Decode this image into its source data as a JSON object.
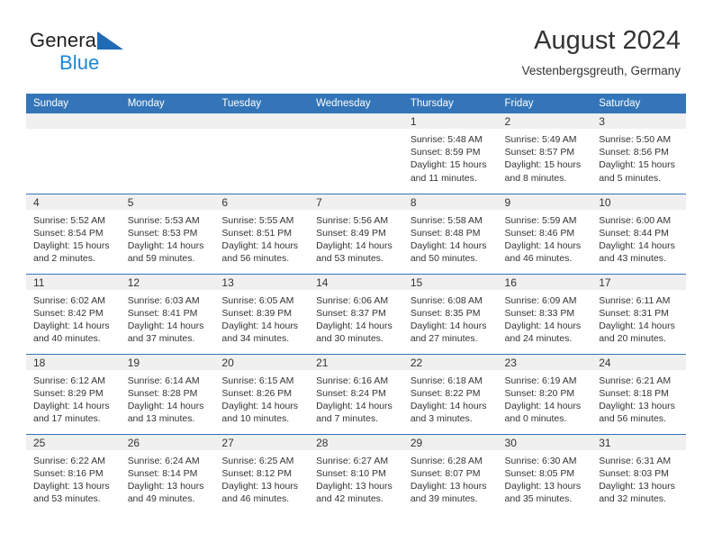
{
  "brand": {
    "name_part1": "General",
    "name_part2": "Blue",
    "triangle_color": "#1f6cb5",
    "blue_color": "#1b87d6"
  },
  "header": {
    "title": "August 2024",
    "subtitle": "Vestenbergsgreuth, Germany"
  },
  "theme": {
    "header_blue": "#3375b8",
    "daynum_gray": "#f0f0f0",
    "text": "#333333"
  },
  "calendar": {
    "weekday_headers": [
      "Sunday",
      "Monday",
      "Tuesday",
      "Wednesday",
      "Thursday",
      "Friday",
      "Saturday"
    ],
    "weeks": [
      [
        {
          "day": "",
          "empty": true
        },
        {
          "day": "",
          "empty": true
        },
        {
          "day": "",
          "empty": true
        },
        {
          "day": "",
          "empty": true
        },
        {
          "day": "1",
          "sunrise": "Sunrise: 5:48 AM",
          "sunset": "Sunset: 8:59 PM",
          "daylight1": "Daylight: 15 hours",
          "daylight2": "and 11 minutes."
        },
        {
          "day": "2",
          "sunrise": "Sunrise: 5:49 AM",
          "sunset": "Sunset: 8:57 PM",
          "daylight1": "Daylight: 15 hours",
          "daylight2": "and 8 minutes."
        },
        {
          "day": "3",
          "sunrise": "Sunrise: 5:50 AM",
          "sunset": "Sunset: 8:56 PM",
          "daylight1": "Daylight: 15 hours",
          "daylight2": "and 5 minutes."
        }
      ],
      [
        {
          "day": "4",
          "sunrise": "Sunrise: 5:52 AM",
          "sunset": "Sunset: 8:54 PM",
          "daylight1": "Daylight: 15 hours",
          "daylight2": "and 2 minutes."
        },
        {
          "day": "5",
          "sunrise": "Sunrise: 5:53 AM",
          "sunset": "Sunset: 8:53 PM",
          "daylight1": "Daylight: 14 hours",
          "daylight2": "and 59 minutes."
        },
        {
          "day": "6",
          "sunrise": "Sunrise: 5:55 AM",
          "sunset": "Sunset: 8:51 PM",
          "daylight1": "Daylight: 14 hours",
          "daylight2": "and 56 minutes."
        },
        {
          "day": "7",
          "sunrise": "Sunrise: 5:56 AM",
          "sunset": "Sunset: 8:49 PM",
          "daylight1": "Daylight: 14 hours",
          "daylight2": "and 53 minutes."
        },
        {
          "day": "8",
          "sunrise": "Sunrise: 5:58 AM",
          "sunset": "Sunset: 8:48 PM",
          "daylight1": "Daylight: 14 hours",
          "daylight2": "and 50 minutes."
        },
        {
          "day": "9",
          "sunrise": "Sunrise: 5:59 AM",
          "sunset": "Sunset: 8:46 PM",
          "daylight1": "Daylight: 14 hours",
          "daylight2": "and 46 minutes."
        },
        {
          "day": "10",
          "sunrise": "Sunrise: 6:00 AM",
          "sunset": "Sunset: 8:44 PM",
          "daylight1": "Daylight: 14 hours",
          "daylight2": "and 43 minutes."
        }
      ],
      [
        {
          "day": "11",
          "sunrise": "Sunrise: 6:02 AM",
          "sunset": "Sunset: 8:42 PM",
          "daylight1": "Daylight: 14 hours",
          "daylight2": "and 40 minutes."
        },
        {
          "day": "12",
          "sunrise": "Sunrise: 6:03 AM",
          "sunset": "Sunset: 8:41 PM",
          "daylight1": "Daylight: 14 hours",
          "daylight2": "and 37 minutes."
        },
        {
          "day": "13",
          "sunrise": "Sunrise: 6:05 AM",
          "sunset": "Sunset: 8:39 PM",
          "daylight1": "Daylight: 14 hours",
          "daylight2": "and 34 minutes."
        },
        {
          "day": "14",
          "sunrise": "Sunrise: 6:06 AM",
          "sunset": "Sunset: 8:37 PM",
          "daylight1": "Daylight: 14 hours",
          "daylight2": "and 30 minutes."
        },
        {
          "day": "15",
          "sunrise": "Sunrise: 6:08 AM",
          "sunset": "Sunset: 8:35 PM",
          "daylight1": "Daylight: 14 hours",
          "daylight2": "and 27 minutes."
        },
        {
          "day": "16",
          "sunrise": "Sunrise: 6:09 AM",
          "sunset": "Sunset: 8:33 PM",
          "daylight1": "Daylight: 14 hours",
          "daylight2": "and 24 minutes."
        },
        {
          "day": "17",
          "sunrise": "Sunrise: 6:11 AM",
          "sunset": "Sunset: 8:31 PM",
          "daylight1": "Daylight: 14 hours",
          "daylight2": "and 20 minutes."
        }
      ],
      [
        {
          "day": "18",
          "sunrise": "Sunrise: 6:12 AM",
          "sunset": "Sunset: 8:29 PM",
          "daylight1": "Daylight: 14 hours",
          "daylight2": "and 17 minutes."
        },
        {
          "day": "19",
          "sunrise": "Sunrise: 6:14 AM",
          "sunset": "Sunset: 8:28 PM",
          "daylight1": "Daylight: 14 hours",
          "daylight2": "and 13 minutes."
        },
        {
          "day": "20",
          "sunrise": "Sunrise: 6:15 AM",
          "sunset": "Sunset: 8:26 PM",
          "daylight1": "Daylight: 14 hours",
          "daylight2": "and 10 minutes."
        },
        {
          "day": "21",
          "sunrise": "Sunrise: 6:16 AM",
          "sunset": "Sunset: 8:24 PM",
          "daylight1": "Daylight: 14 hours",
          "daylight2": "and 7 minutes."
        },
        {
          "day": "22",
          "sunrise": "Sunrise: 6:18 AM",
          "sunset": "Sunset: 8:22 PM",
          "daylight1": "Daylight: 14 hours",
          "daylight2": "and 3 minutes."
        },
        {
          "day": "23",
          "sunrise": "Sunrise: 6:19 AM",
          "sunset": "Sunset: 8:20 PM",
          "daylight1": "Daylight: 14 hours",
          "daylight2": "and 0 minutes."
        },
        {
          "day": "24",
          "sunrise": "Sunrise: 6:21 AM",
          "sunset": "Sunset: 8:18 PM",
          "daylight1": "Daylight: 13 hours",
          "daylight2": "and 56 minutes."
        }
      ],
      [
        {
          "day": "25",
          "sunrise": "Sunrise: 6:22 AM",
          "sunset": "Sunset: 8:16 PM",
          "daylight1": "Daylight: 13 hours",
          "daylight2": "and 53 minutes."
        },
        {
          "day": "26",
          "sunrise": "Sunrise: 6:24 AM",
          "sunset": "Sunset: 8:14 PM",
          "daylight1": "Daylight: 13 hours",
          "daylight2": "and 49 minutes."
        },
        {
          "day": "27",
          "sunrise": "Sunrise: 6:25 AM",
          "sunset": "Sunset: 8:12 PM",
          "daylight1": "Daylight: 13 hours",
          "daylight2": "and 46 minutes."
        },
        {
          "day": "28",
          "sunrise": "Sunrise: 6:27 AM",
          "sunset": "Sunset: 8:10 PM",
          "daylight1": "Daylight: 13 hours",
          "daylight2": "and 42 minutes."
        },
        {
          "day": "29",
          "sunrise": "Sunrise: 6:28 AM",
          "sunset": "Sunset: 8:07 PM",
          "daylight1": "Daylight: 13 hours",
          "daylight2": "and 39 minutes."
        },
        {
          "day": "30",
          "sunrise": "Sunrise: 6:30 AM",
          "sunset": "Sunset: 8:05 PM",
          "daylight1": "Daylight: 13 hours",
          "daylight2": "and 35 minutes."
        },
        {
          "day": "31",
          "sunrise": "Sunrise: 6:31 AM",
          "sunset": "Sunset: 8:03 PM",
          "daylight1": "Daylight: 13 hours",
          "daylight2": "and 32 minutes."
        }
      ]
    ]
  }
}
